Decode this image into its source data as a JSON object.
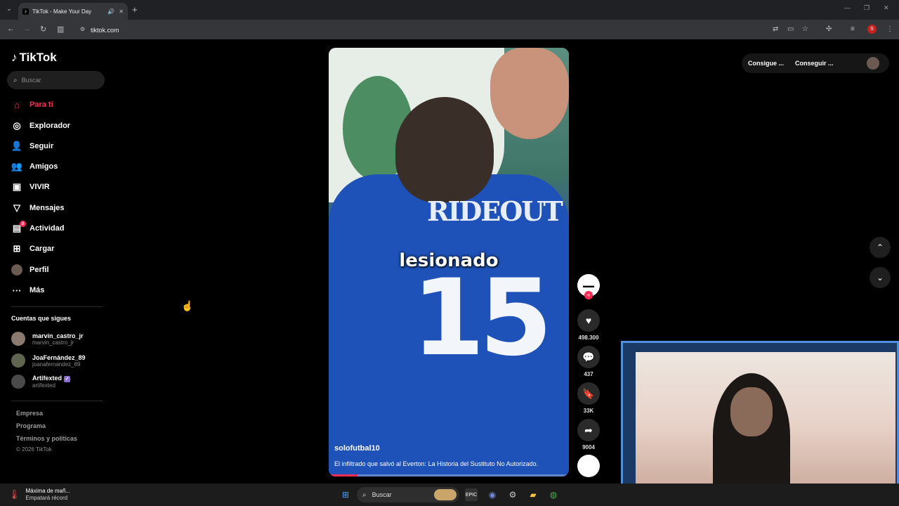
{
  "browser": {
    "tab_title": "TikTok - Make Your Day",
    "url": "tiktok.com",
    "profile_initial": "S"
  },
  "sidebar": {
    "logo": "TikTok",
    "search_placeholder": "Buscar",
    "nav": [
      {
        "label": "Para ti",
        "icon": "home-icon",
        "active": true
      },
      {
        "label": "Explorador",
        "icon": "compass-icon"
      },
      {
        "label": "Seguir",
        "icon": "follow-icon"
      },
      {
        "label": "Amigos",
        "icon": "friends-icon"
      },
      {
        "label": "VIVIR",
        "icon": "live-icon"
      },
      {
        "label": "Mensajes",
        "icon": "messages-icon"
      },
      {
        "label": "Actividad",
        "icon": "activity-icon",
        "badge": "8"
      },
      {
        "label": "Cargar",
        "icon": "upload-icon"
      },
      {
        "label": "Perfil",
        "icon": "avatar"
      },
      {
        "label": "Más",
        "icon": "more-icon"
      }
    ],
    "following_title": "Cuentas que sigues",
    "following": [
      {
        "name": "marvin_castro_jr",
        "handle": "marvin_castro_jr"
      },
      {
        "name": "JoaFernández_89",
        "handle": "joanafernandez_89"
      },
      {
        "name": "Artifexted",
        "handle": "artifexted",
        "verified": true
      }
    ],
    "footer": [
      "Empresa",
      "Programa",
      "Términos y políticas"
    ],
    "copyright": "© 2026 TikTok"
  },
  "video": {
    "caption_overlay": "lesionado",
    "jersey_name": "RIDEOUT",
    "jersey_number": "15",
    "username": "solofutbal10",
    "description": "El infiltrado que salvó al Everton: La Historia del Sustituto No Autorizado.",
    "progress": 0.12
  },
  "actions": {
    "likes": "498.300",
    "comments": "437",
    "saves": "33K",
    "shares": "9004"
  },
  "topright": {
    "btn1": "Consigue ...",
    "btn2": "Conseguir ..."
  },
  "taskbar": {
    "weather_line1": "Máxima de mañ...",
    "weather_line2": "Empatará récord",
    "search": "Buscar"
  },
  "colors": {
    "accent": "#fe2c55",
    "webcam_border": "#4f8fe0"
  }
}
